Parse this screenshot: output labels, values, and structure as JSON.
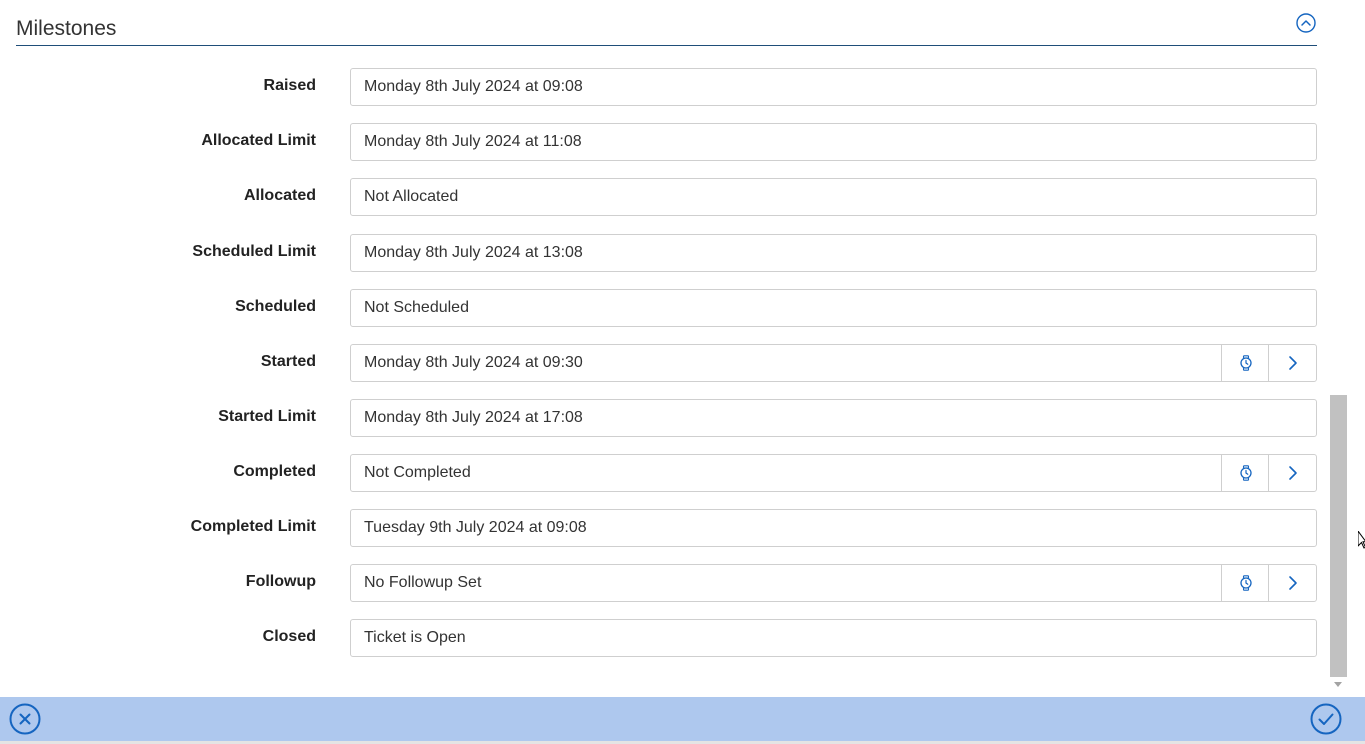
{
  "section": {
    "title": "Milestones"
  },
  "milestones": [
    {
      "label": "Raised",
      "value": "Monday 8th July 2024 at 09:08"
    },
    {
      "label": "Allocated Limit",
      "value": "Monday 8th July 2024 at 11:08"
    },
    {
      "label": "Allocated",
      "value": "Not Allocated"
    },
    {
      "label": "Scheduled Limit",
      "value": "Monday 8th July 2024 at 13:08"
    },
    {
      "label": "Scheduled",
      "value": "Not Scheduled"
    },
    {
      "label": "Started",
      "value": "Monday 8th July 2024 at 09:30"
    },
    {
      "label": "Started Limit",
      "value": "Monday 8th July 2024 at 17:08"
    },
    {
      "label": "Completed",
      "value": "Not Completed"
    },
    {
      "label": "Completed Limit",
      "value": "Tuesday 9th July 2024 at 09:08"
    },
    {
      "label": "Followup",
      "value": "No Followup Set"
    },
    {
      "label": "Closed",
      "value": "Ticket is Open"
    }
  ],
  "icons": {
    "collapse": "chevron-up-circle-icon",
    "timer": "stopwatch-icon",
    "next": "chevron-right-icon",
    "cancel": "close-circle-icon",
    "confirm": "check-circle-icon"
  },
  "colors": {
    "accent": "#1565c0",
    "header_rule": "#1f4e79",
    "footer": "#aec8ee",
    "border": "#cfcfcf",
    "scroll_thumb": "#c1c1c1"
  }
}
